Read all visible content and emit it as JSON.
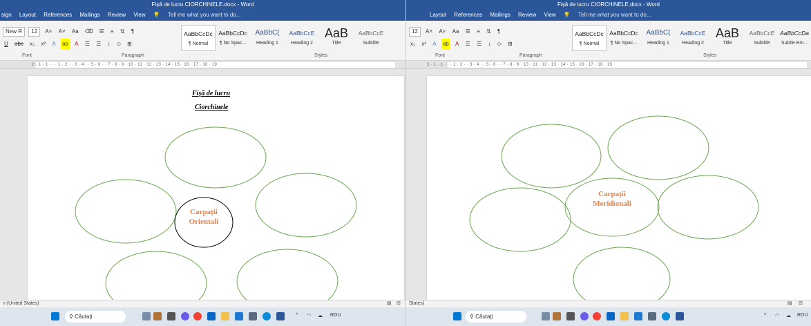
{
  "window_title": "Fișă de lucru CIORCHINELE.docx - Word",
  "tabs_left": [
    "sign",
    "Layout",
    "References",
    "Mailings",
    "Review",
    "View"
  ],
  "tabs_right": [
    "Layout",
    "References",
    "Mailings",
    "Review",
    "View"
  ],
  "tell_me": "Tell me what you want to do...",
  "font_name": "New R",
  "font_size": "12",
  "styles": [
    {
      "sample": "AaBbCcDc",
      "name": "¶ Normal"
    },
    {
      "sample": "AaBbCcDc",
      "name": "¶ No Spac..."
    },
    {
      "sample": "AaBbC(",
      "name": "Heading 1"
    },
    {
      "sample": "AaBbCcE",
      "name": "Heading 2"
    },
    {
      "sample": "AaB",
      "name": "Title"
    },
    {
      "sample": "AaBbCcE",
      "name": "Subtitle"
    },
    {
      "sample": "AaBbCcDa",
      "name": "Subtle Em..."
    }
  ],
  "groups": {
    "font": "Font",
    "paragraph": "Paragraph",
    "styles": "Styles"
  },
  "ruler_text": "2 · 1 · 1 · · · 1 · 2 · · 3 · 4 · · 5 · 6 · · 7 · 8 · 9 · 10 · 11 · 12 · 13 · 14 · 15 · 16 · 17 · 18 · 19",
  "left_doc": {
    "title1": "Fișă de lucru",
    "title2": "Ciorchinele",
    "center_line1": "Carpații",
    "center_line2": "Orientali"
  },
  "right_doc": {
    "center_line1": "Carpații",
    "center_line2": "Meridionali"
  },
  "status_left": "n (United States)",
  "status_right": "States)",
  "taskbar": {
    "search_label": "Căutați",
    "language": "ROU"
  },
  "colors": {
    "title_blue": "#2b579a",
    "ellipse_green": "#6aa84f",
    "center_orange": "#f08040",
    "taskbar_bg": "#dde5ef"
  }
}
